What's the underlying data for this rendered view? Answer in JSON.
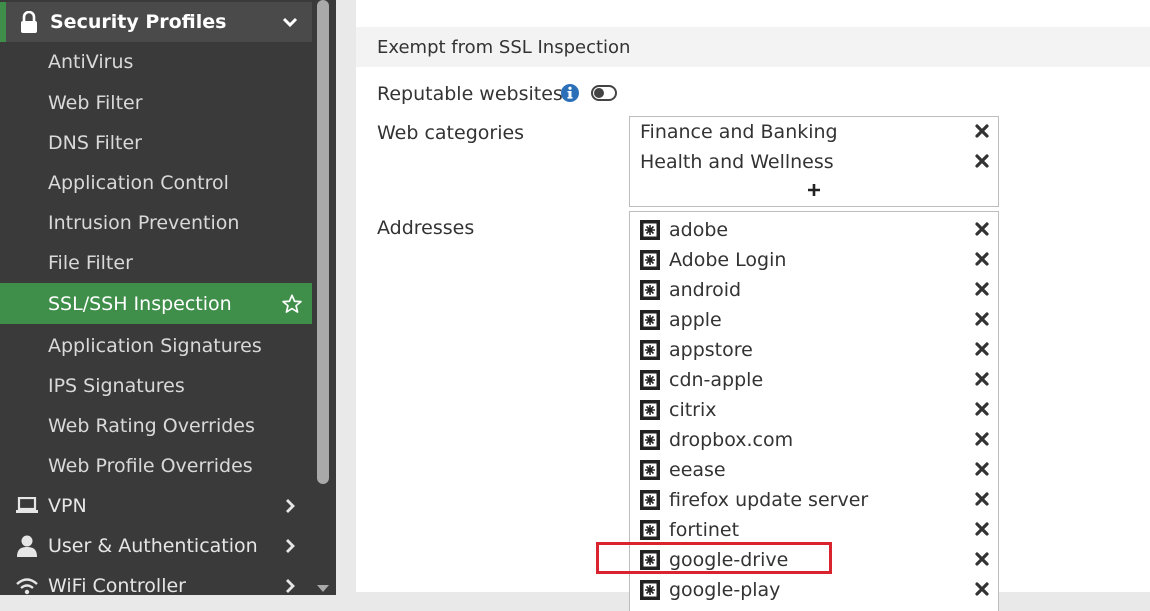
{
  "sidebar": {
    "section": {
      "label": "Security Profiles",
      "icon": "lock-icon"
    },
    "items": [
      {
        "label": "AntiVirus"
      },
      {
        "label": "Web Filter"
      },
      {
        "label": "DNS Filter"
      },
      {
        "label": "Application Control"
      },
      {
        "label": "Intrusion Prevention"
      },
      {
        "label": "File Filter"
      },
      {
        "label": "SSL/SSH Inspection",
        "active": true
      },
      {
        "label": "Application Signatures"
      },
      {
        "label": "IPS Signatures"
      },
      {
        "label": "Web Rating Overrides"
      },
      {
        "label": "Web Profile Overrides"
      }
    ],
    "top_items": [
      {
        "label": "VPN",
        "icon": "monitor-icon"
      },
      {
        "label": "User & Authentication",
        "icon": "user-icon"
      },
      {
        "label": "WiFi Controller",
        "icon": "wifi-icon"
      }
    ]
  },
  "main": {
    "section_title": "Exempt from SSL Inspection",
    "reputable_label": "Reputable websites",
    "reputable_enabled": false,
    "web_categories_label": "Web categories",
    "web_categories": [
      "Finance and Banking",
      "Health and Wellness"
    ],
    "addresses_label": "Addresses",
    "addresses": [
      "adobe",
      "Adobe Login",
      "android",
      "apple",
      "appstore",
      "cdn-apple",
      "citrix",
      "dropbox.com",
      "eease",
      "firefox update server",
      "fortinet",
      "google-drive",
      "google-play"
    ],
    "highlighted_address": "google-drive"
  },
  "colors": {
    "sidebar_bg": "#3a3a3a",
    "active_green": "#3f8f4a",
    "highlight_red": "#d9232e",
    "info_blue": "#2a6fb8"
  }
}
